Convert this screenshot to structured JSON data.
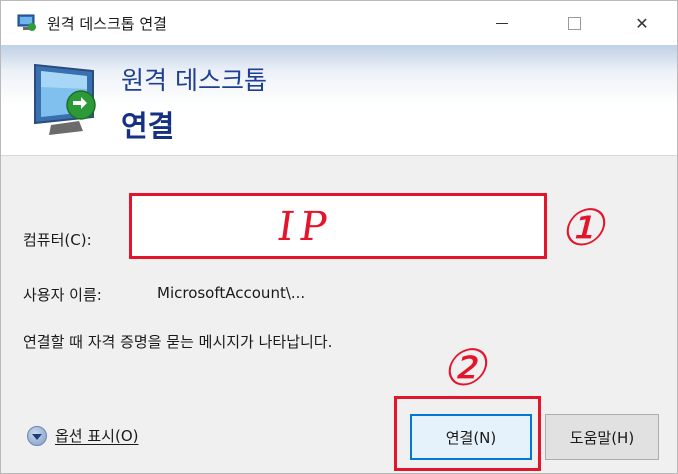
{
  "window": {
    "title": "원격 데스크톱 연결",
    "controls": {
      "minimize_icon": "minimize-icon",
      "maximize_icon": "maximize-icon",
      "close_icon": "close-icon"
    }
  },
  "header": {
    "line1": "원격 데스크톱",
    "line2": "연결"
  },
  "form": {
    "computer_label": "컴퓨터(C):",
    "computer_annotation": "IP",
    "username_label": "사용자 이름:",
    "username_value": "MicrosoftAccount\\...",
    "info_text": "연결할 때 자격 증명을 묻는 메시지가 나타납니다."
  },
  "annotations": {
    "marker1": "①",
    "marker2": "②",
    "color": "#e4142b"
  },
  "footer": {
    "options_label": "옵션 표시(O)",
    "connect_label": "연결(N)",
    "help_label": "도움말(H)"
  },
  "colors": {
    "header_title": "#1f3f92",
    "accent": "#0078d7"
  }
}
